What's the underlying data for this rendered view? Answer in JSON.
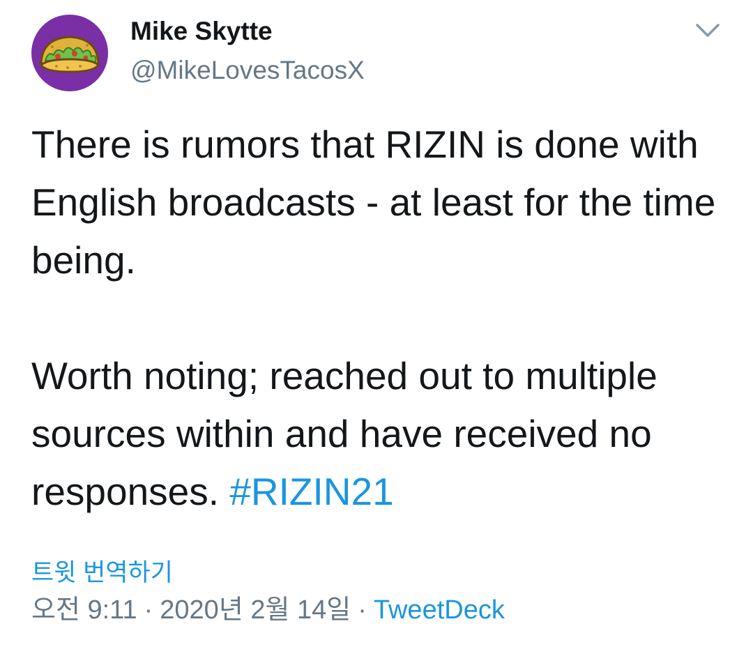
{
  "user": {
    "display_name": "Mike Skytte",
    "handle": "@MikeLovesTacosX",
    "avatar_icon": "taco-icon"
  },
  "menu": {
    "icon": "chevron-down-icon"
  },
  "tweet": {
    "paragraph1": "There is rumors that RIZIN is done with English broadcasts - at least for the time being.",
    "paragraph2_text": "Worth noting; reached out to multiple sources within and have received no responses.",
    "hashtag": "#RIZIN21"
  },
  "translate_label": "트윗 번역하기",
  "meta": {
    "time": "오전 9:11",
    "separator": "·",
    "date": "2020년 2월 14일",
    "source": "TweetDeck"
  },
  "colors": {
    "link": "#1b95e0",
    "secondary_text": "#657786",
    "avatar_bg": "#7a2fa6"
  }
}
